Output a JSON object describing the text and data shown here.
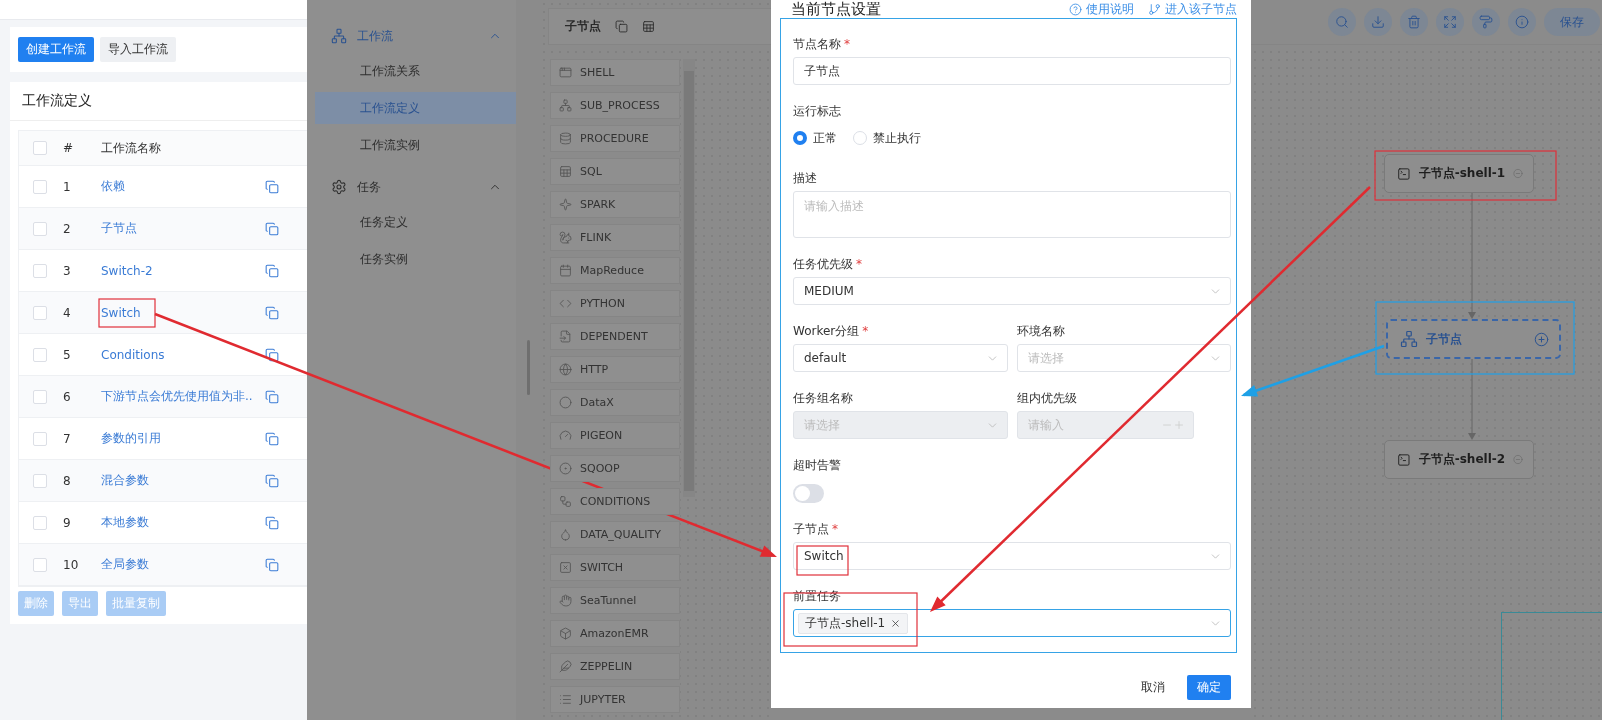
{
  "workflow_list": {
    "buttons": [
      {
        "label": "创建工作流",
        "kind": "primary"
      },
      {
        "label": "导入工作流",
        "kind": "default"
      }
    ],
    "card_title": "工作流定义",
    "table": {
      "columns": [
        "#",
        "工作流名称"
      ],
      "header_checked": false,
      "rows": [
        {
          "index": "1",
          "name": "依赖",
          "checked": false
        },
        {
          "index": "2",
          "name": "子节点",
          "checked": false
        },
        {
          "index": "3",
          "name": "Switch-2",
          "checked": false
        },
        {
          "index": "4",
          "name": "Switch",
          "checked": false
        },
        {
          "index": "5",
          "name": "Conditions",
          "checked": false
        },
        {
          "index": "6",
          "name": "下游节点会优先使用值为非..",
          "checked": false
        },
        {
          "index": "7",
          "name": "参数的引用",
          "checked": false
        },
        {
          "index": "8",
          "name": "混合参数",
          "checked": false
        },
        {
          "index": "9",
          "name": "本地参数",
          "checked": false
        },
        {
          "index": "10",
          "name": "全局参数",
          "checked": false
        }
      ]
    },
    "footer_buttons": [
      {
        "label": "删除",
        "disabled": true
      },
      {
        "label": "导出",
        "disabled": true
      },
      {
        "label": "批量复制",
        "disabled": true
      }
    ]
  },
  "sidebar": {
    "groups": [
      {
        "label": "工作流",
        "expanded": true,
        "selected": true,
        "items": [
          {
            "label": "工作流关系",
            "selected": false
          },
          {
            "label": "工作流定义",
            "selected": true
          },
          {
            "label": "工作流实例",
            "selected": false
          }
        ]
      },
      {
        "label": "任务",
        "expanded": true,
        "selected": false,
        "items": [
          {
            "label": "任务定义",
            "selected": false
          },
          {
            "label": "任务实例",
            "selected": false
          }
        ]
      }
    ]
  },
  "editor": {
    "title": "子节点",
    "task_types": [
      "SHELL",
      "SUB_PROCESS",
      "PROCEDURE",
      "SQL",
      "SPARK",
      "FLINK",
      "MapReduce",
      "PYTHON",
      "DEPENDENT",
      "HTTP",
      "DataX",
      "PIGEON",
      "SQOOP",
      "CONDITIONS",
      "DATA_QUALITY",
      "SWITCH",
      "SeaTunnel",
      "AmazonEMR",
      "ZEPPELIN",
      "JUPYTER"
    ],
    "toolbar": {
      "save_label": "保存"
    },
    "nodes": [
      {
        "label": "子节点-shell-1",
        "kind": "shell",
        "selected": false
      },
      {
        "label": "子节点",
        "kind": "sub_process",
        "selected": true
      },
      {
        "label": "子节点-shell-2",
        "kind": "shell",
        "selected": false
      }
    ]
  },
  "dialog": {
    "title": "当前节点设置",
    "required_marker": "*",
    "links": [
      {
        "label": "使用说明",
        "kind": "help"
      },
      {
        "label": "进入该子节点",
        "kind": "enter"
      }
    ],
    "fields": [
      {
        "kind": "text",
        "label": "节点名称",
        "required": true,
        "value": "子节点"
      },
      {
        "kind": "radio",
        "label": "运行标志",
        "options": [
          {
            "label": "正常",
            "selected": true
          },
          {
            "label": "禁止执行",
            "selected": false
          }
        ]
      },
      {
        "kind": "textarea",
        "label": "描述",
        "placeholder": "请输入描述"
      },
      {
        "kind": "select",
        "label": "任务优先级",
        "required": true,
        "value": "MEDIUM"
      },
      {
        "kind": "pair",
        "items": [
          {
            "kind": "select",
            "label": "Worker分组",
            "required": true,
            "value": "default"
          },
          {
            "kind": "select",
            "label": "环境名称",
            "placeholder": "请选择"
          }
        ]
      },
      {
        "kind": "pair",
        "items": [
          {
            "kind": "select",
            "label": "任务组名称",
            "placeholder": "请选择",
            "disabled": true
          },
          {
            "kind": "number",
            "label": "组内优先级",
            "placeholder": "请输入",
            "disabled": true
          }
        ]
      },
      {
        "kind": "switch",
        "label": "超时告警",
        "on": false
      },
      {
        "kind": "select",
        "label": "子节点",
        "required": true,
        "value": "Switch"
      },
      {
        "kind": "tags",
        "label": "前置任务",
        "tags": [
          "子节点-shell-1"
        ]
      }
    ],
    "buttons": [
      {
        "label": "取消",
        "kind": "default"
      },
      {
        "label": "确定",
        "kind": "primary"
      }
    ]
  }
}
